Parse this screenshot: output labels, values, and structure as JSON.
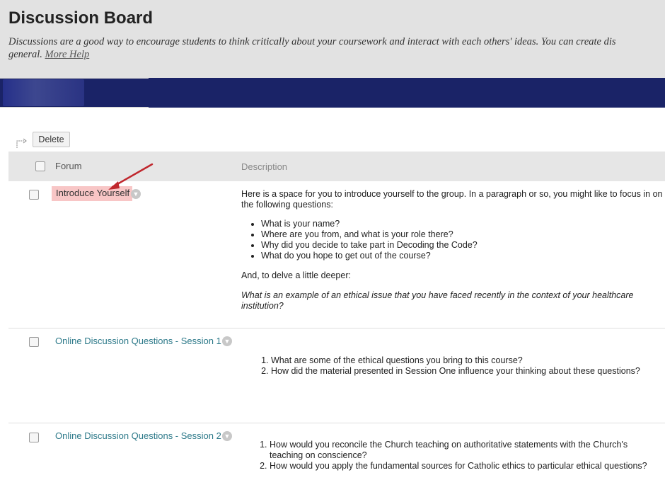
{
  "header": {
    "title": "Discussion Board",
    "intro": "Discussions are a good way to encourage students to think critically about your coursework and interact with each others' ideas. You can create dis",
    "intro_line2": "general.",
    "more_help": "More Help"
  },
  "toolbar": {
    "delete_label": "Delete"
  },
  "table": {
    "col_forum": "Forum",
    "col_description": "Description"
  },
  "forums": [
    {
      "name": "Introduce Yourself",
      "desc_intro": "Here is a space for you to introduce yourself to the group. In a paragraph or so, you might like to focus in on the following questions:",
      "bullets": [
        "What is your name?",
        "Where are you from, and what is your role there?",
        "Why did you decide to take part in Decoding the Code?",
        "What do you hope to get out of the course?"
      ],
      "desc_more": "And, to delve a little deeper:",
      "desc_question": "What is an example of an ethical issue that you have faced recently in the context of your healthcare institution?"
    },
    {
      "name": "Online Discussion Questions - Session 1",
      "items": [
        "What are some of the ethical questions you bring to this course?",
        "How did the material presented in Session One influence your thinking about these questions?"
      ]
    },
    {
      "name": "Online Discussion Questions - Session 2",
      "items": [
        "How would you reconcile the Church teaching on authoritative statements with the Church's teaching on conscience?",
        "How would you apply the fundamental sources for Catholic ethics to particular ethical questions?"
      ]
    }
  ],
  "colors": {
    "nav": "#1a2367",
    "link": "#2e7a8a",
    "highlight": "#f8c6c6",
    "arrow": "#c0272d"
  }
}
